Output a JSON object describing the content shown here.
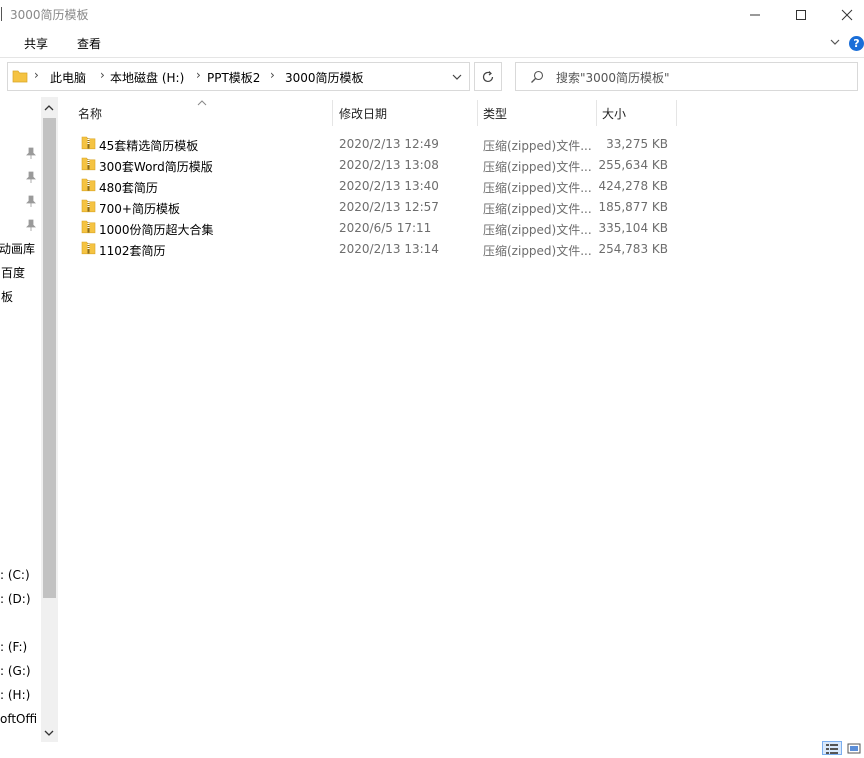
{
  "window": {
    "title": "3000简历模板"
  },
  "ribbon": {
    "tabs": [
      "共享",
      "查看"
    ],
    "help": "?"
  },
  "address": {
    "crumbs": [
      "此电脑",
      "本地磁盘 (H:)",
      "PPT模板2",
      "3000简历模板"
    ],
    "sep": "›"
  },
  "search": {
    "placeholder": "搜索\"3000简历模板\""
  },
  "nav": {
    "items": [
      "动画库",
      "百度",
      "板",
      ": (C:)",
      ": (D:)",
      ": (F:)",
      ": (G:)",
      ": (H:)",
      "oftOffi"
    ]
  },
  "columns": {
    "name": "名称",
    "date": "修改日期",
    "type": "类型",
    "size": "大小"
  },
  "files": [
    {
      "name": "45套精选简历模板",
      "date": "2020/2/13 12:49",
      "type": "压缩(zipped)文件...",
      "size": "33,275 KB"
    },
    {
      "name": "300套Word简历模版",
      "date": "2020/2/13 13:08",
      "type": "压缩(zipped)文件...",
      "size": "255,634 KB"
    },
    {
      "name": "480套简历",
      "date": "2020/2/13 13:40",
      "type": "压缩(zipped)文件...",
      "size": "424,278 KB"
    },
    {
      "name": "700+简历模板",
      "date": "2020/2/13 12:57",
      "type": "压缩(zipped)文件...",
      "size": "185,877 KB"
    },
    {
      "name": "1000份简历超大合集",
      "date": "2020/6/5 17:11",
      "type": "压缩(zipped)文件...",
      "size": "335,104 KB"
    },
    {
      "name": "1102套简历",
      "date": "2020/2/13 13:14",
      "type": "压缩(zipped)文件...",
      "size": "254,783 KB"
    }
  ],
  "icons": {
    "folder": "folder-icon",
    "zip": "zip-folder-icon",
    "pin": "pin-icon",
    "refresh": "refresh-icon",
    "search": "search-icon"
  },
  "colors": {
    "accent": "#1a6ed8",
    "folder": "#f5c342",
    "muted": "#6d6d6d"
  }
}
